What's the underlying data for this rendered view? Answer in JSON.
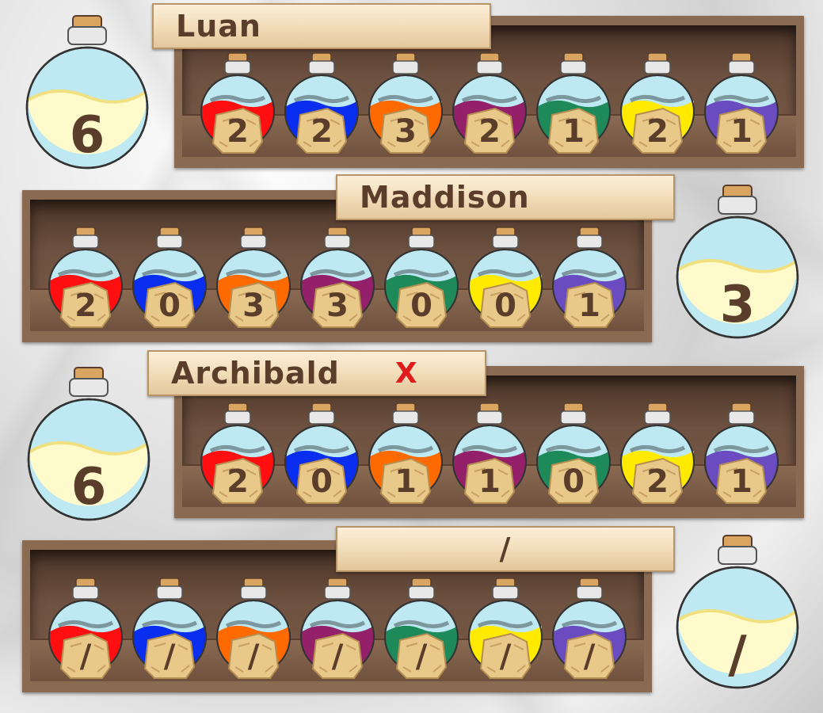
{
  "colors": {
    "red": "#ff0f0f",
    "blue": "#0a2ef0",
    "orange": "#ff6a00",
    "purple": "#95206a",
    "green": "#1e8a5a",
    "yellow": "#ffea00",
    "violet": "#6a4cc0"
  },
  "potion_order": [
    "red",
    "blue",
    "orange",
    "purple",
    "green",
    "yellow",
    "violet"
  ],
  "players": [
    {
      "name": "Luan",
      "mark": "",
      "total": "6",
      "counts": [
        "2",
        "2",
        "3",
        "2",
        "1",
        "2",
        "1"
      ]
    },
    {
      "name": "Maddison",
      "mark": "",
      "total": "3",
      "counts": [
        "2",
        "0",
        "3",
        "3",
        "0",
        "0",
        "1"
      ]
    },
    {
      "name": "Archibald",
      "mark": "X",
      "total": "6",
      "counts": [
        "2",
        "0",
        "1",
        "1",
        "0",
        "2",
        "1"
      ]
    },
    {
      "name": "/",
      "mark": "",
      "total": "/",
      "counts": [
        "/",
        "/",
        "/",
        "/",
        "/",
        "/",
        "/"
      ]
    }
  ]
}
